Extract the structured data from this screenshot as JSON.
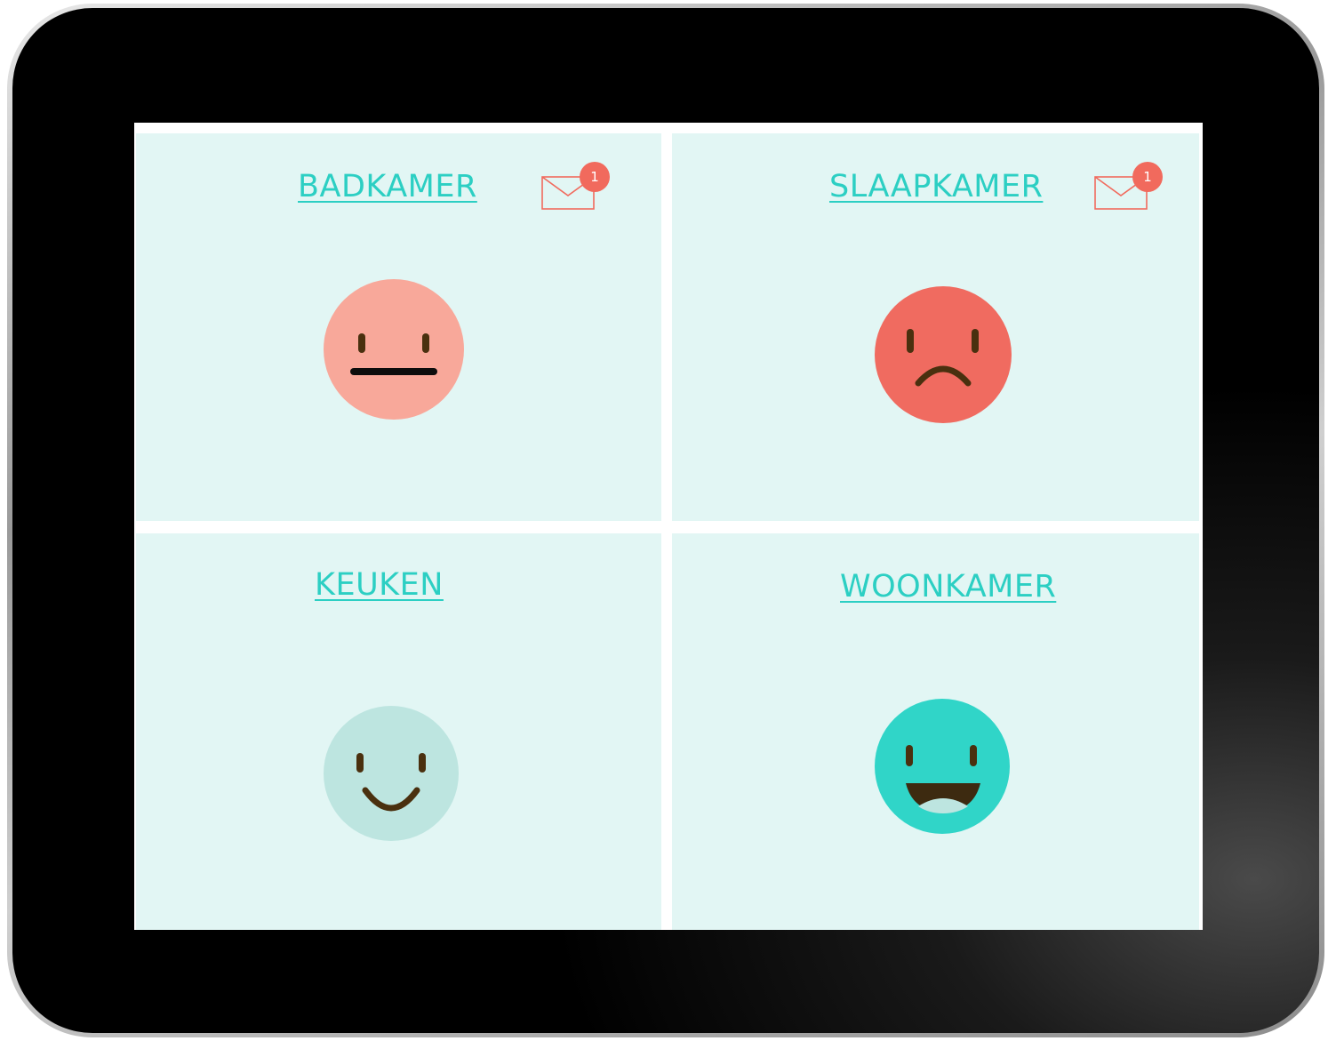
{
  "rooms": [
    {
      "name": "BADKAMER",
      "mood": "neutral",
      "color": "#f8a89a",
      "notifications": "1"
    },
    {
      "name": "SLAAPKAMER",
      "mood": "sad",
      "color": "#f06b60",
      "notifications": "1"
    },
    {
      "name": "KEUKEN",
      "mood": "smile",
      "color": "#bde5e0"
    },
    {
      "name": "WOONKAMER",
      "mood": "happy",
      "color": "#30d5c8"
    }
  ],
  "colors": {
    "panel_background": "#e2f6f4",
    "title": "#2ccfc3",
    "badge": "#f16a5d",
    "face_features": "#4a300f"
  },
  "icons": {
    "mail": "envelope-icon",
    "neutral": "neutral-face-icon",
    "sad": "sad-face-icon",
    "smile": "smile-face-icon",
    "happy": "happy-face-icon"
  }
}
